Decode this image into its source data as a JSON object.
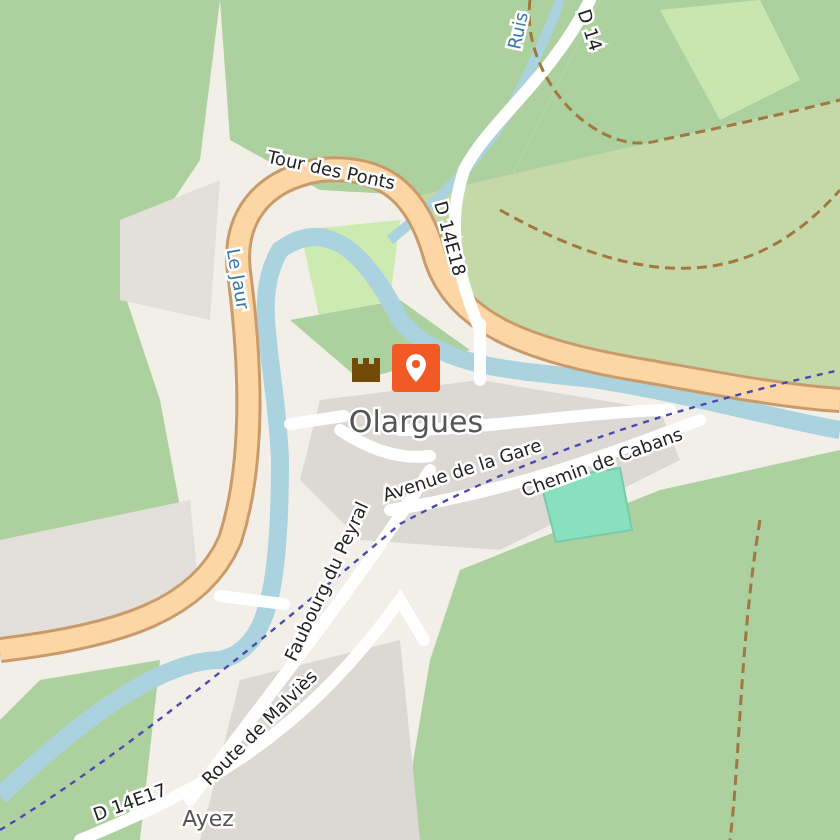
{
  "map": {
    "labels": [
      {
        "text": "Tour des Ponts",
        "kind": "road"
      },
      {
        "text": "Le Jaur",
        "kind": "river"
      },
      {
        "text": "D 14E18",
        "kind": "road"
      },
      {
        "text": "Olargues",
        "kind": "place"
      },
      {
        "text": "Avenue de la Gare",
        "kind": "road"
      },
      {
        "text": "Chemin de Cabans",
        "kind": "road"
      },
      {
        "text": "Faubourg du Peyral",
        "kind": "road"
      },
      {
        "text": "Route de Malviès",
        "kind": "road"
      },
      {
        "text": "D 14E17",
        "kind": "road"
      },
      {
        "text": "Ayez",
        "kind": "place"
      },
      {
        "text": "Ruis",
        "kind": "river"
      },
      {
        "text": "D 14",
        "kind": "road"
      }
    ]
  }
}
